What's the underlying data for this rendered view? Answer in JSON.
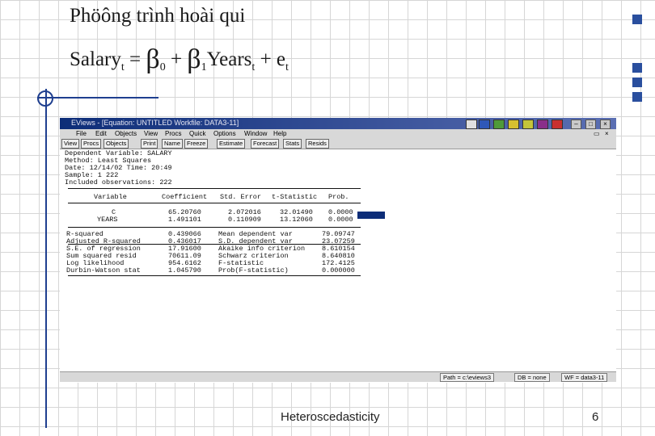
{
  "slide": {
    "title": "Phöông trình hoài qui",
    "formula": {
      "y": "Salary",
      "y_sub": "t",
      "equals": "=",
      "beta": "β",
      "b0_sub": "0",
      "plus": "+",
      "b1_sub": "1",
      "x": "Years",
      "x_sub": "t",
      "e": "e",
      "e_sub": "t"
    },
    "footer_center": "Heteroscedasticity",
    "page_number": "6"
  },
  "window": {
    "title": "EViews - [Equation: UNTITLED   Workfile: DATA3-11]",
    "menu": [
      "File",
      "Edit",
      "Objects",
      "View",
      "Procs",
      "Quick",
      "Options",
      "Window",
      "Help"
    ],
    "toolbar": [
      "View",
      "Procs",
      "Objects",
      "Print",
      "Name",
      "Freeze",
      "Estimate",
      "Forecast",
      "Stats",
      "Resids"
    ],
    "header_lines": [
      "Dependent Variable: SALARY",
      "Method: Least Squares",
      "Date: 12/14/02   Time: 20:49",
      "Sample: 1 222",
      "Included observations: 222"
    ],
    "coef_table": {
      "headers": [
        "Variable",
        "Coefficient",
        "Std. Error",
        "t-Statistic",
        "Prob."
      ],
      "rows": [
        [
          "C",
          "65.20760",
          "2.072016",
          "32.01490",
          "0.0000"
        ],
        [
          "YEARS",
          "1.491101",
          "0.110909",
          "13.12060",
          "0.0000"
        ]
      ]
    },
    "stats": [
      [
        "R-squared",
        "0.439066",
        "Mean dependent var",
        "79.09747"
      ],
      [
        "Adjusted R-squared",
        "0.436017",
        "S.D. dependent var",
        "23.07259"
      ],
      [
        "S.E. of regression",
        "17.91600",
        "Akaike info criterion",
        "8.610154"
      ],
      [
        "Sum squared resid",
        "70611.09",
        "Schwarz criterion",
        "8.640810"
      ],
      [
        "Log likelihood",
        "954.6162",
        "F-statistic",
        "172.4125"
      ],
      [
        "Durbin-Watson stat",
        "1.045790",
        "Prob(F-statistic)",
        "0.000000"
      ]
    ],
    "status": {
      "path": "Path = c:\\eviews3",
      "db": "DB = none",
      "wf": "WF = data3-11"
    }
  }
}
